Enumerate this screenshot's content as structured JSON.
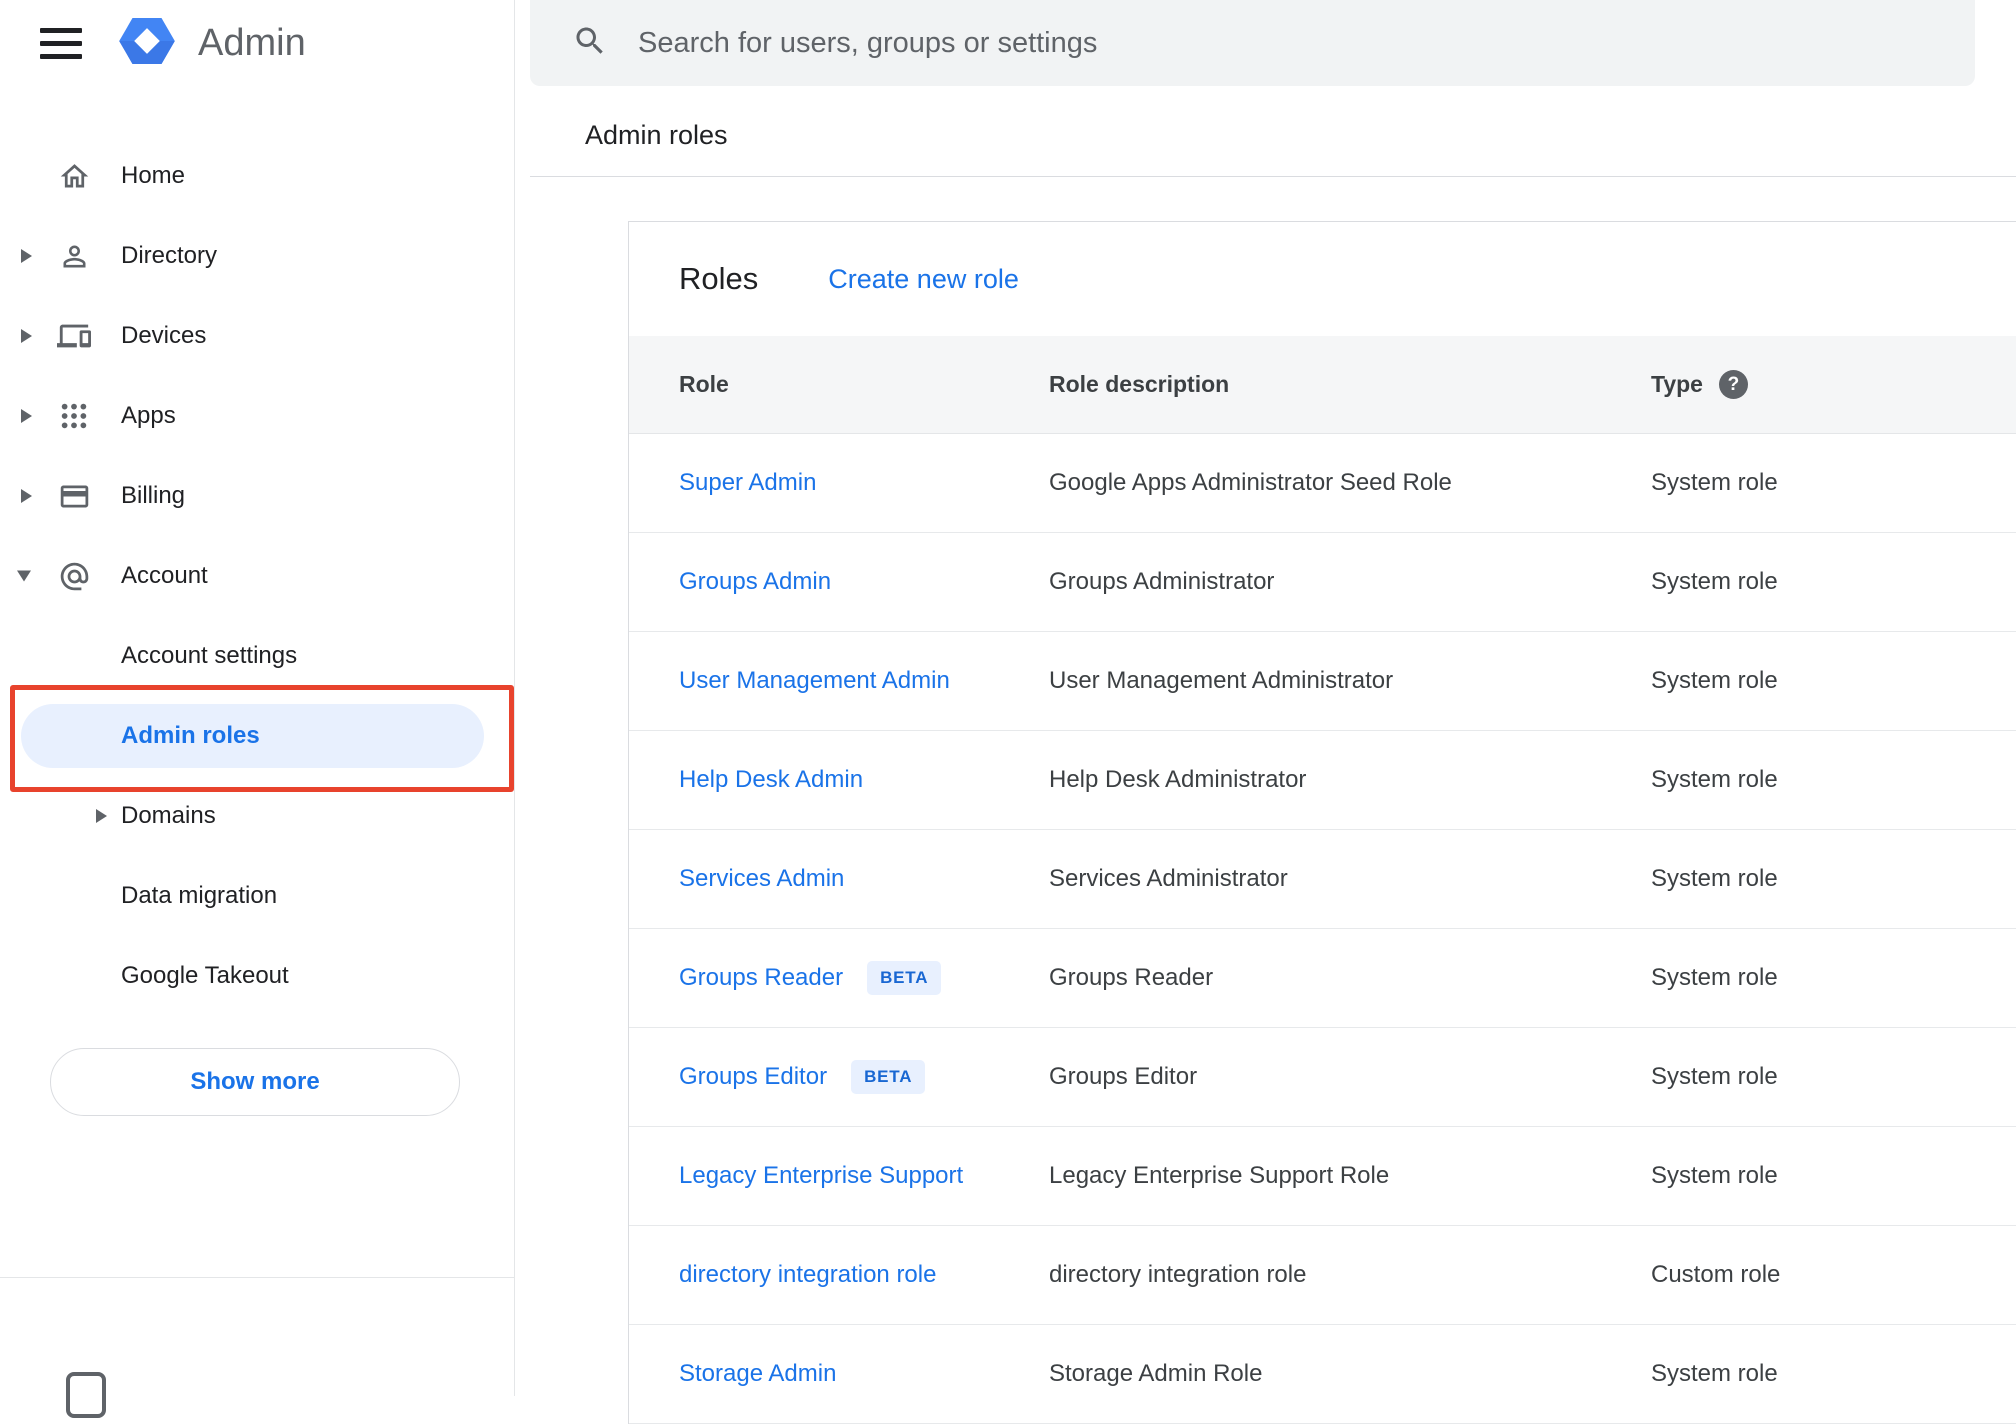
{
  "header": {
    "app_title": "Admin",
    "menu_icon": "hamburger-icon",
    "logo_icon": "admin-hexagon-logo",
    "search": {
      "placeholder": "Search for users, groups or settings",
      "icon": "search-icon"
    },
    "breadcrumb": "Admin roles"
  },
  "sidebar": {
    "items": [
      {
        "label": "Home",
        "icon": "home-icon"
      },
      {
        "label": "Directory",
        "icon": "person-icon",
        "expandable": true
      },
      {
        "label": "Devices",
        "icon": "devices-icon",
        "expandable": true
      },
      {
        "label": "Apps",
        "icon": "apps-grid-icon",
        "expandable": true
      },
      {
        "label": "Billing",
        "icon": "credit-card-icon",
        "expandable": true
      },
      {
        "label": "Account",
        "icon": "at-sign-icon",
        "expanded": true
      },
      {
        "label": "Account settings",
        "child": true
      },
      {
        "label": "Admin roles",
        "child": true,
        "selected": true,
        "annotated": true
      },
      {
        "label": "Domains",
        "child": true,
        "expandable": true
      },
      {
        "label": "Data migration",
        "child": true
      },
      {
        "label": "Google Takeout",
        "child": true
      }
    ],
    "show_more": "Show more"
  },
  "roles_panel": {
    "title": "Roles",
    "create_new_role": "Create new role",
    "table": {
      "headers": {
        "role": "Role",
        "description": "Role description",
        "type": "Type"
      },
      "type_help_icon": "help-circle-icon",
      "help_glyph": "?",
      "beta_label": "BETA",
      "rows": [
        {
          "role": "Super Admin",
          "description": "Google Apps Administrator Seed Role",
          "type": "System role",
          "beta": false
        },
        {
          "role": "Groups Admin",
          "description": "Groups Administrator",
          "type": "System role",
          "beta": false
        },
        {
          "role": "User Management Admin",
          "description": "User Management Administrator",
          "type": "System role",
          "beta": false
        },
        {
          "role": "Help Desk Admin",
          "description": "Help Desk Administrator",
          "type": "System role",
          "beta": false
        },
        {
          "role": "Services Admin",
          "description": "Services Administrator",
          "type": "System role",
          "beta": false
        },
        {
          "role": "Groups Reader",
          "description": "Groups Reader",
          "type": "System role",
          "beta": true
        },
        {
          "role": "Groups Editor",
          "description": "Groups Editor",
          "type": "System role",
          "beta": true
        },
        {
          "role": "Legacy Enterprise Support",
          "description": "Legacy Enterprise Support Role",
          "type": "System role",
          "beta": false
        },
        {
          "role": "directory integration role",
          "description": "directory integration role",
          "type": "Custom role",
          "beta": false
        },
        {
          "role": "Storage Admin",
          "description": "Storage Admin Role",
          "type": "System role",
          "beta": false
        }
      ]
    }
  },
  "annotation": {
    "type": "highlight-box",
    "target": "Admin roles"
  },
  "colors": {
    "link_blue": "#1a73e8",
    "selected_item_bg": "#e8f0fe",
    "selected_item_text": "#1a73e8",
    "beta_badge_bg": "#e8f0fe",
    "beta_badge_text": "#1967d2",
    "annotation_red": "#e8432d",
    "search_bar_bg": "#f1f3f4",
    "table_header_bg": "#f5f6f7",
    "icon_gray": "#5f6368",
    "text_primary": "#202124",
    "text_secondary": "#3c4043"
  }
}
